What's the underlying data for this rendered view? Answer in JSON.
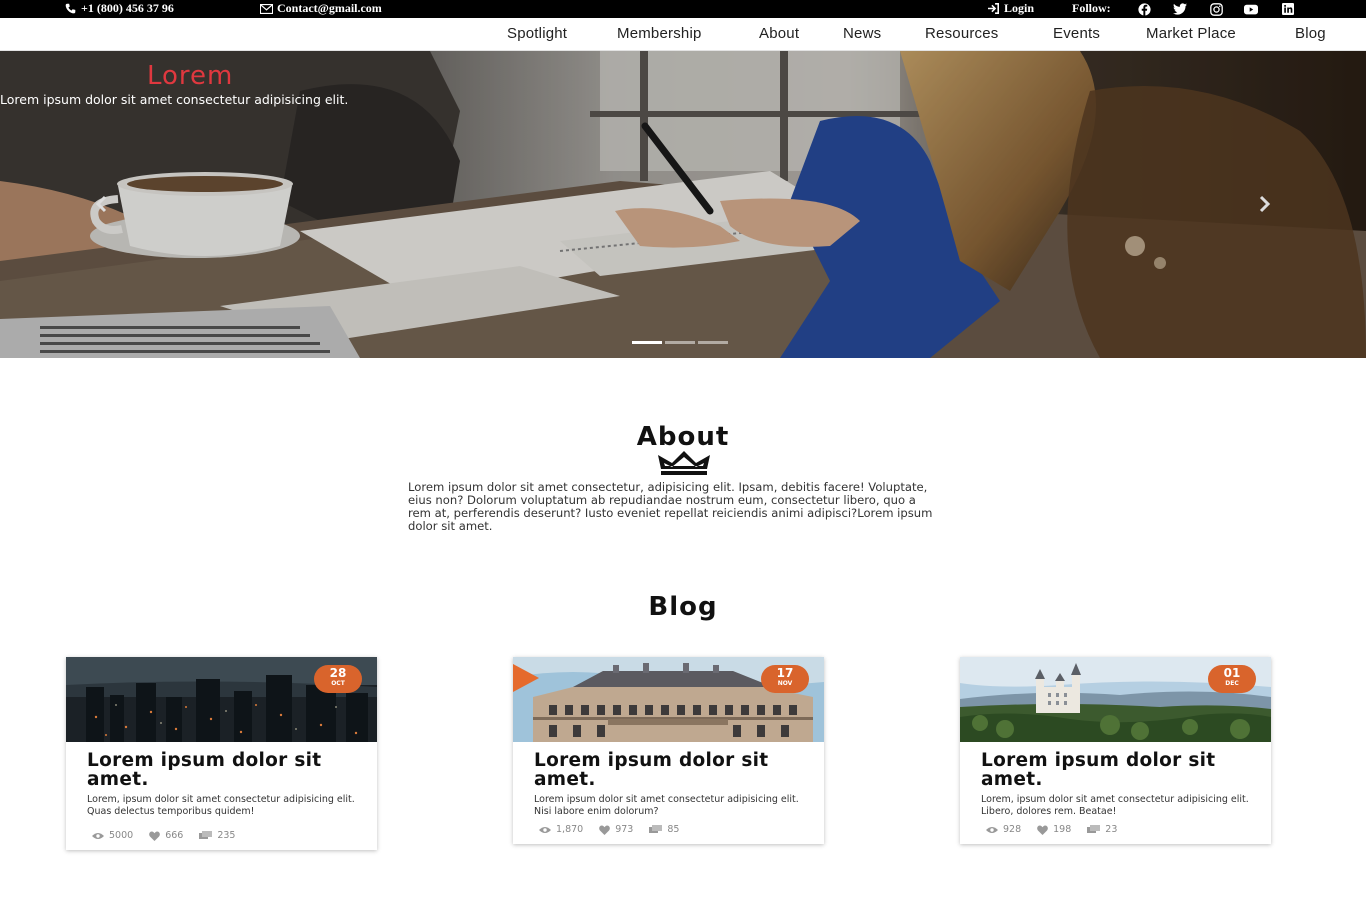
{
  "topbar": {
    "phone": "+1 (800) 456 37 96",
    "email": "Contact@gmail.com",
    "login": "Login",
    "follow": "Follow:",
    "social": [
      "facebook-icon",
      "twitter-icon",
      "instagram-icon",
      "youtube-icon",
      "linkedin-icon"
    ]
  },
  "nav": [
    "Spotlight",
    "Membership",
    "About",
    "News",
    "Resources",
    "Events",
    "Market Place",
    "Blog"
  ],
  "hero": {
    "title": "Lorem",
    "subtitle": "Lorem ipsum dolor sit amet consectetur adipisicing elit.",
    "slides": 3,
    "active_slide": 1
  },
  "about": {
    "title": "About",
    "text": "Lorem ipsum dolor sit amet consectetur, adipisicing elit. Ipsam, debitis facere! Voluptate, eius non? Dolorum voluptatum ab repudiandae nostrum eum, consectetur libero, quo a rem at, perferendis deserunt? Iusto eveniet repellat reiciendis animi adipisci?Lorem ipsum dolor sit amet."
  },
  "blog": {
    "title": "Blog",
    "cards": [
      {
        "day": "28",
        "month": "OCT",
        "title": "Lorem ipsum dolor sit amet.",
        "text": "Lorem, ipsum dolor sit amet consectetur adipisicing elit. Quas delectus temporibus quidem!",
        "views": "5000",
        "likes": "666",
        "comments": "235",
        "image": "city-night"
      },
      {
        "day": "17",
        "month": "NOV",
        "title": "Lorem ipsum dolor sit amet.",
        "text": "Lorem ipsum dolor sit amet consectetur adipisicing elit. Nisi labore enim dolorum?",
        "views": "1,870",
        "likes": "973",
        "comments": "85",
        "image": "hotel-building"
      },
      {
        "day": "01",
        "month": "DEC",
        "title": "Lorem ipsum dolor sit amet.",
        "text": "Lorem, ipsum dolor sit amet consectetur adipisicing elit. Libero, dolores rem. Beatae!",
        "views": "928",
        "likes": "198",
        "comments": "23",
        "image": "castle-landscape"
      }
    ]
  },
  "colors": {
    "accent": "#e0383f",
    "date_badge": "#d9642c",
    "topbar": "#000000"
  }
}
